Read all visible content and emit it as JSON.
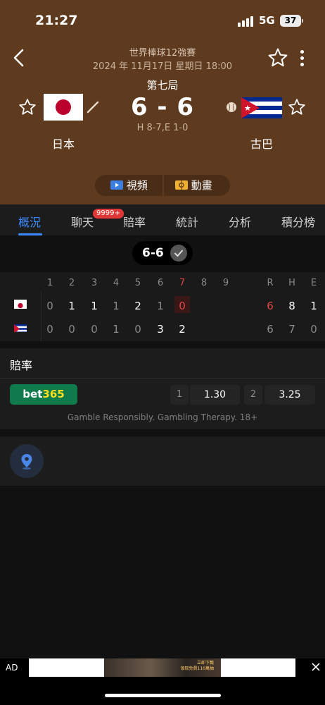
{
  "status_bar": {
    "time": "21:27",
    "network": "5G",
    "battery": "37"
  },
  "match": {
    "league": "世界棒球12強賽",
    "datetime": "2024 年 11月17日 星期日 18:00",
    "inning": "第七局",
    "score": "6 - 6",
    "stats_line": "H 8-7,E 1-0",
    "home_team": "日本",
    "away_team": "古巴"
  },
  "media": {
    "video_label": "視頻",
    "animation_label": "動畫"
  },
  "tabs": [
    {
      "label": "概況",
      "active": true
    },
    {
      "label": "聊天"
    },
    {
      "label": "賠率"
    },
    {
      "label": "統計"
    },
    {
      "label": "分析"
    },
    {
      "label": "積分榜"
    }
  ],
  "chat_badge": "9999+",
  "score_pill": "6-6",
  "linescore": {
    "innings": [
      "1",
      "2",
      "3",
      "4",
      "5",
      "6",
      "7",
      "8",
      "9"
    ],
    "totals_headers": [
      "R",
      "H",
      "E"
    ],
    "rows": [
      {
        "team": "日本",
        "innings": [
          "0",
          "1",
          "1",
          "1",
          "2",
          "1",
          "0",
          "",
          ""
        ],
        "R": "6",
        "H": "8",
        "E": "1"
      },
      {
        "team": "古巴",
        "innings": [
          "0",
          "0",
          "0",
          "1",
          "0",
          "3",
          "2",
          "",
          ""
        ],
        "R": "6",
        "H": "7",
        "E": "0"
      }
    ]
  },
  "odds": {
    "title": "賠率",
    "bookmaker_part1": "bet",
    "bookmaker_part2": "365",
    "option1_label": "1",
    "option1_value": "1.30",
    "option2_label": "2",
    "option2_value": "3.25",
    "disclaimer": "Gamble Responsibly. Gambling Therapy. 18+"
  },
  "ad": {
    "tag": "AD",
    "image_text_1": "立即下載",
    "image_text_2": "領取免費110萬抽"
  },
  "colors": {
    "header_bg": "#5e3a1e",
    "accent": "#3d8bff",
    "badge": "#e03838",
    "bet365_green": "#0f7a4c"
  },
  "icons": [
    "back-icon",
    "star-icon",
    "more-icon",
    "bat-icon",
    "baseball-icon",
    "video-icon",
    "animation-icon",
    "check-icon",
    "location-icon",
    "close-icon"
  ]
}
